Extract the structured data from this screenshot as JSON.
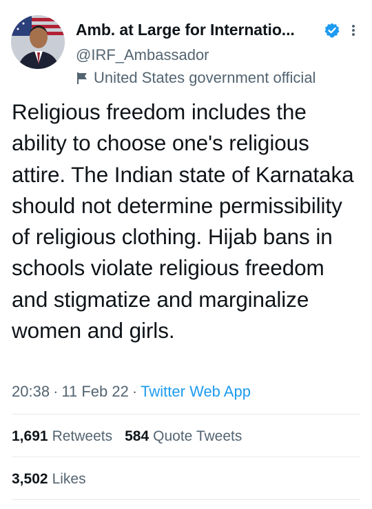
{
  "author": {
    "display_name": "Amb. at Large for Internatio...",
    "handle": "@IRF_Ambassador",
    "label": "United States government official",
    "verified_color": "#1d9bf0"
  },
  "icons": {
    "verified": "verified-badge-icon",
    "more": "more-options-icon",
    "government_label": "flag-icon"
  },
  "tweet": {
    "text": "Religious freedom includes the ability to choose one's religious attire. The Indian state of Karnataka should not determine permissibility of religious clothing. Hijab bans in schools violate religious freedom and stigmatize and marginalize women and girls.",
    "time": "20:38",
    "date": "11 Feb 22",
    "source": "Twitter Web App",
    "separator": "·"
  },
  "stats": {
    "retweets_count": "1,691",
    "retweets_label": "Retweets",
    "quote_count": "584",
    "quote_label": "Quote Tweets",
    "likes_count": "3,502",
    "likes_label": "Likes"
  },
  "colors": {
    "text_primary": "#0f1419",
    "text_secondary": "#536471",
    "link": "#1d9bf0",
    "divider": "#e5e9ec"
  }
}
